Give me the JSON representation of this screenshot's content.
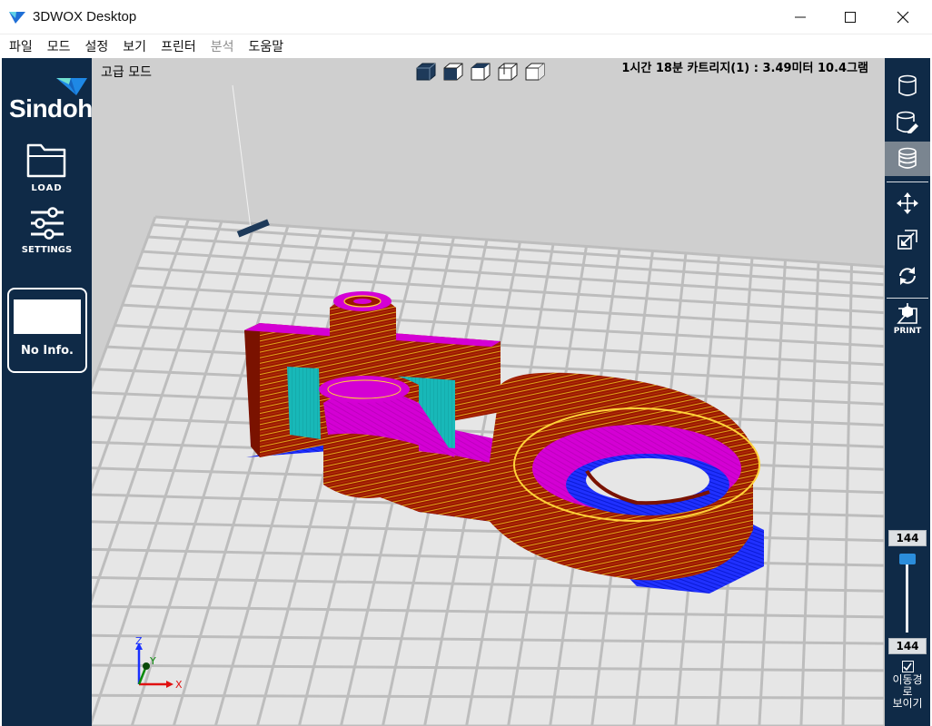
{
  "window": {
    "title": "3DWOX Desktop"
  },
  "menu": [
    {
      "label": "파일",
      "enabled": true
    },
    {
      "label": "모드",
      "enabled": true
    },
    {
      "label": "설정",
      "enabled": true
    },
    {
      "label": "보기",
      "enabled": true
    },
    {
      "label": "프린터",
      "enabled": true
    },
    {
      "label": "분석",
      "enabled": false
    },
    {
      "label": "도움말",
      "enabled": true
    }
  ],
  "sidebar": {
    "logo_text": "Sindoh",
    "load_label": "LOAD",
    "settings_label": "SETTINGS",
    "info_text": "No Info."
  },
  "viewport": {
    "mode_label": "고급 모드",
    "print_info": "1시간 18분  카트리지(1) : 3.49미터 10.4그램",
    "view_cube_icons": [
      "view-cube-solid-icon",
      "view-cube-front-icon",
      "view-cube-top-icon",
      "view-cube-left-icon",
      "view-cube-right-icon"
    ],
    "axis_labels": {
      "x": "X",
      "y": "Y",
      "z": "Z"
    },
    "colors": {
      "background": "#cfcfcf",
      "grid_tile": "#e6e6e6",
      "wall": "#a01a00",
      "wall_line": "#e8b31e",
      "infill": "#d400d4",
      "support": "#16b4b4",
      "brim": "#1a26ff"
    }
  },
  "toolbar": {
    "tools": [
      {
        "name": "model-view-icon",
        "active": false
      },
      {
        "name": "model-edit-icon",
        "active": false
      },
      {
        "name": "layer-view-icon",
        "active": true
      },
      {
        "name": "move-icon",
        "active": false
      },
      {
        "name": "scale-icon",
        "active": false
      },
      {
        "name": "rotate-icon",
        "active": false
      }
    ],
    "print_label": "PRINT",
    "layer_top": "144",
    "layer_bottom": "144",
    "layer_fraction": 1.0,
    "path_toggle_checked": true,
    "path_toggle_label": [
      "이동경",
      "로",
      "보이기"
    ]
  }
}
